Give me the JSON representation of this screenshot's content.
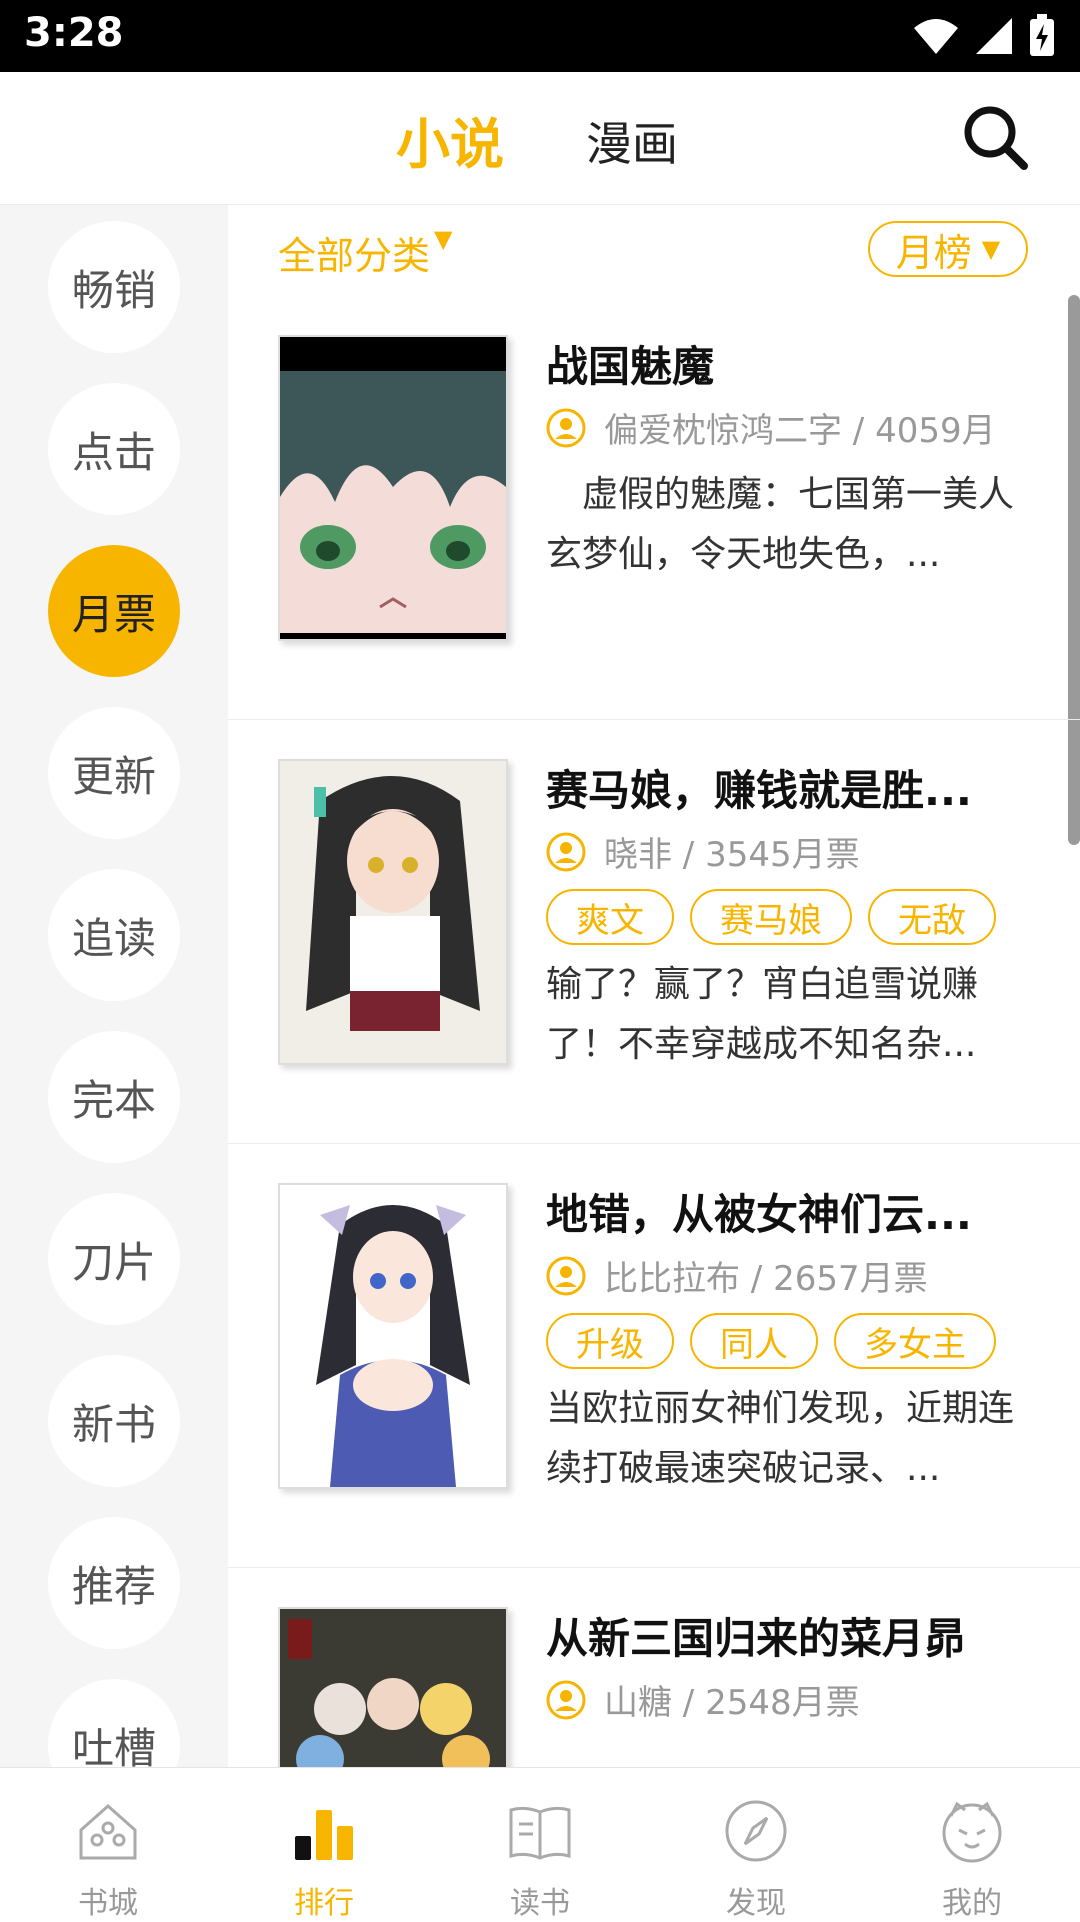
{
  "status": {
    "time": "3:28"
  },
  "header": {
    "tabs": [
      "小说",
      "漫画"
    ],
    "active_tab": "小说"
  },
  "sidebar": {
    "items": [
      "畅销",
      "点击",
      "月票",
      "更新",
      "追读",
      "完本",
      "刀片",
      "新书",
      "推荐",
      "吐槽"
    ],
    "active": "月票"
  },
  "filters": {
    "category": "全部分类",
    "ranking": "月榜"
  },
  "books": [
    {
      "title": "战国魅魔",
      "author_line": "偏爱枕惊鸿二字 / 4059月",
      "tags": [],
      "desc": "　虚假的魅魔：七国第一美人玄梦仙，令天地失色，..."
    },
    {
      "title": "赛马娘，赚钱就是胜...",
      "author_line": "晓非 / 3545月票",
      "tags": [
        "爽文",
        "赛马娘",
        "无敌"
      ],
      "desc": "输了？赢了？宵白追雪说赚了！不幸穿越成不知名杂..."
    },
    {
      "title": "地错，从被女神们云...",
      "author_line": "比比拉布 / 2657月票",
      "tags": [
        "升级",
        "同人",
        "多女主"
      ],
      "desc": "当欧拉丽女神们发现，近期连续打破最速突破记录、..."
    },
    {
      "title": "从新三国归来的菜月昴",
      "author_line": "山糖 / 2548月票",
      "tags": [],
      "desc": ""
    }
  ],
  "bottom_nav": {
    "items": [
      "书城",
      "排行",
      "读书",
      "发现",
      "我的"
    ],
    "active": "排行"
  },
  "colors": {
    "accent": "#f7b500",
    "text": "#111111",
    "muted": "#999999"
  }
}
